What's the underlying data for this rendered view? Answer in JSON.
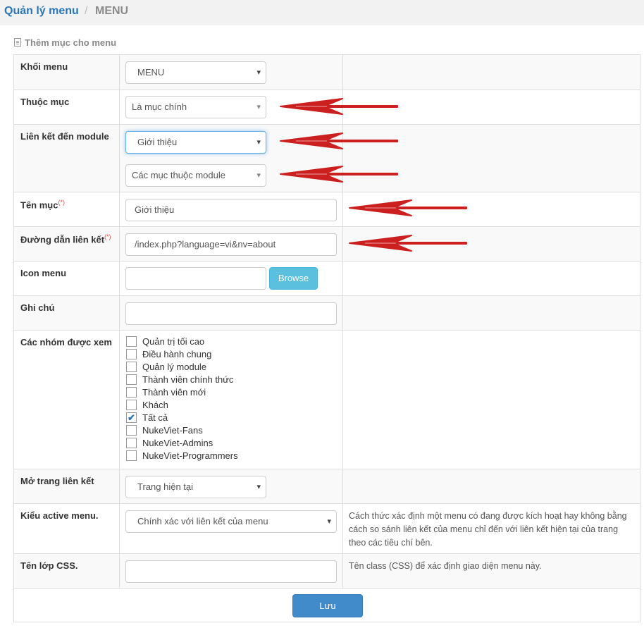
{
  "breadcrumb": {
    "first": "Quản lý menu",
    "sep": "/",
    "last": "MENU"
  },
  "panel": {
    "title": "Thêm mục cho menu"
  },
  "form": {
    "block": {
      "label": "Khối menu",
      "value": "MENU"
    },
    "parent": {
      "label": "Thuộc mục",
      "value": "Là mục chính"
    },
    "module": {
      "label": "Liên kết đến module",
      "value": "Giới thiệu",
      "sub_value": "Các mục thuộc module"
    },
    "title": {
      "label": "Tên mục",
      "required": "(*)",
      "value": "Giới thiệu"
    },
    "link": {
      "label": "Đường dẫn liên kết",
      "required": "(*)",
      "value": "/index.php?language=vi&nv=about"
    },
    "icon": {
      "label": "Icon menu",
      "value": "",
      "browse": "Browse"
    },
    "note": {
      "label": "Ghi chú",
      "value": ""
    },
    "groups": {
      "label": "Các nhóm được xem",
      "options": [
        {
          "label": "Quản trị tối cao",
          "checked": false
        },
        {
          "label": "Điều hành chung",
          "checked": false
        },
        {
          "label": "Quản lý module",
          "checked": false
        },
        {
          "label": "Thành viên chính thức",
          "checked": false
        },
        {
          "label": "Thành viên mới",
          "checked": false
        },
        {
          "label": "Khách",
          "checked": false
        },
        {
          "label": "Tất cả",
          "checked": true
        },
        {
          "label": "NukeViet-Fans",
          "checked": false
        },
        {
          "label": "NukeViet-Admins",
          "checked": false
        },
        {
          "label": "NukeViet-Programmers",
          "checked": false
        }
      ]
    },
    "target": {
      "label": "Mở trang liên kết",
      "value": "Trang hiện tại"
    },
    "active": {
      "label": "Kiểu active menu.",
      "value": "Chính xác với liên kết của menu",
      "help": "Cách thức xác định một menu có đang được kích hoạt hay không bằng cách so sánh liên kết của menu chỉ đến với liên kết hiện tại của trang theo các tiêu chí bên."
    },
    "css": {
      "label": "Tên lớp CSS.",
      "value": "",
      "help": "Tên class (CSS) để xác định giao diện menu này."
    },
    "submit": "Lưu"
  },
  "colors": {
    "link": "#2a76b8",
    "annotation_arrow": "#cc1f1f",
    "save_button": "#428bca",
    "browse_button": "#5bc0de"
  }
}
